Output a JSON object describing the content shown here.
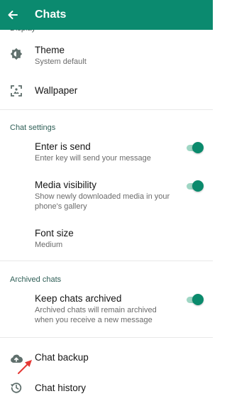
{
  "appbar": {
    "title": "Chats",
    "back_icon": "arrow-left-icon",
    "color": "#0b8a6f"
  },
  "display_section": {
    "header": "Display",
    "theme": {
      "title": "Theme",
      "subtitle": "System default",
      "icon": "brightness-icon"
    },
    "wallpaper": {
      "title": "Wallpaper",
      "icon": "wallpaper-icon"
    }
  },
  "chat_settings": {
    "header": "Chat settings",
    "enter_is_send": {
      "title": "Enter is send",
      "subtitle": "Enter key will send your message",
      "enabled": true
    },
    "media_visibility": {
      "title": "Media visibility",
      "subtitle": "Show newly downloaded media in your phone's gallery",
      "enabled": true
    },
    "font_size": {
      "title": "Font size",
      "subtitle": "Medium"
    }
  },
  "archived_chats": {
    "header": "Archived chats",
    "keep_archived": {
      "title": "Keep chats archived",
      "subtitle": "Archived chats will remain archived when you receive a new message",
      "enabled": true
    }
  },
  "bottom_items": {
    "chat_backup": {
      "title": "Chat backup",
      "icon": "cloud-upload-icon"
    },
    "chat_history": {
      "title": "Chat history",
      "icon": "history-icon"
    }
  },
  "accent_color": "#0a8a6c",
  "annotation_color": "#e53935"
}
